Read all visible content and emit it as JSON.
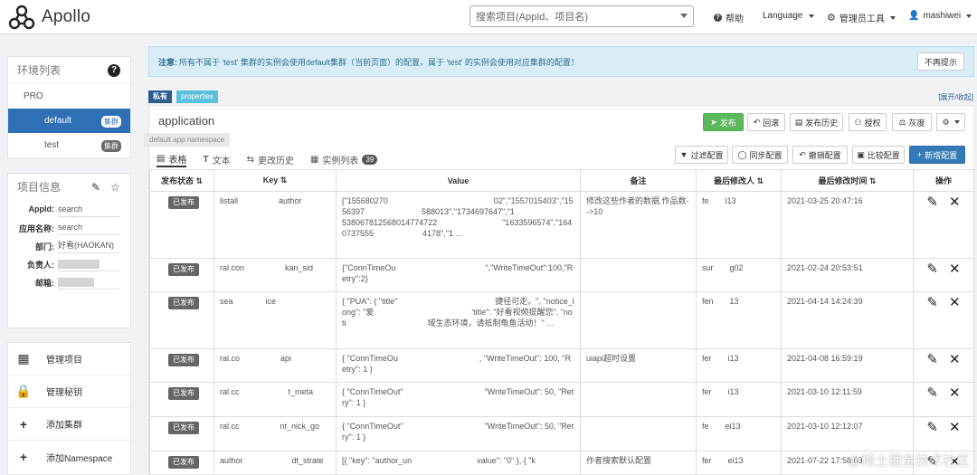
{
  "app": {
    "name": "Apollo"
  },
  "header": {
    "search_placeholder": "搜索项目(AppId、项目名)",
    "help": "帮助",
    "language": "Language",
    "admin_tools": "管理员工具",
    "user": "mashiwei"
  },
  "env": {
    "title": "环境列表",
    "help": "?",
    "env_name": "PRO",
    "clusters": [
      {
        "name": "default",
        "tag": "集群",
        "active": true
      },
      {
        "name": "test",
        "tag": "集群",
        "active": false
      }
    ]
  },
  "project_info": {
    "title": "项目信息",
    "rows": [
      {
        "label": "AppId:",
        "value": "search"
      },
      {
        "label": "应用名称:",
        "value": "search"
      },
      {
        "label": "部门:",
        "value": "好看(HAOKAN)"
      },
      {
        "label": "负责人:",
        "value": ""
      },
      {
        "label": "邮箱:",
        "value": ""
      }
    ]
  },
  "actions": [
    {
      "icon": "grid-icon",
      "label": "管理项目"
    },
    {
      "icon": "lock-icon",
      "label": "管理秘钥"
    },
    {
      "icon": "plus-icon",
      "label": "添加集群"
    },
    {
      "icon": "plus-icon",
      "label": "添加Namespace"
    }
  ],
  "notice": {
    "prefix": "注意:",
    "text": "所有不属于 'test' 集群的实例会使用default集群（当前页面）的配置，属于 'test' 的实例会使用对应集群的配置！",
    "button": "不再提示"
  },
  "namespace": {
    "badge_private": "私有",
    "badge_format": "properties",
    "expand": "[展开/收起]",
    "title": "application",
    "tooltip": "default app namespace",
    "buttons": {
      "publish": "发布",
      "rollback": "回滚",
      "history": "发布历史",
      "grant": "授权",
      "gray": "灰度",
      "filter": "过滤配置",
      "sync": "同步配置",
      "revoke": "撤销配置",
      "compare": "比较配置",
      "add": "新增配置"
    },
    "tabs": [
      {
        "label": "表格",
        "active": true
      },
      {
        "label": "文本",
        "active": false
      },
      {
        "label": "更改历史",
        "active": false
      },
      {
        "label": "实例列表",
        "active": false,
        "count": "39"
      }
    ],
    "columns": [
      "发布状态",
      "Key",
      "Value",
      "备注",
      "最后修改人",
      "最后修改时间",
      "操作"
    ],
    "rows": [
      {
        "status": "已发布",
        "key": "listall　　　　　author",
        "value": "[\"155680270　　　　　　　　　　　　　02\",\"1557015403\",\"1556397　　　　　　　588013\",\"1734697647\",\"1　　　　　　　　　　538067812568014774722　　　　　　　　\"1633596574\",\"1640737555　　　　　　4178\",\"1 ...",
        "remark": "修改这些作者的数据.作品数-->10",
        "user": "fe　　i13",
        "time": "2021-03-25 20:47:16"
      },
      {
        "status": "已发布",
        "key": "ral.con　　　　　kan_sid",
        "value": "{\"ConnTimeOu　　　　　　　　　　　\",\"WriteTimeOut\":100,\"Retry\":2}",
        "remark": "",
        "user": "sur　　g02",
        "time": "2021-02-24 20:53:51"
      },
      {
        "status": "已发布",
        "key": "sea　　　　ice",
        "value": "{ \"PUA\": { \"title\"　　　　　　　　　　　　捷径可走。\", \"notice_long\": \"爱　　　　　　　　　　　　'title\": \"好看视频提醒您\", \"noti　　　　　　　　　　域生态环境，请抵制龟鱼活动！\" ...",
        "remark": "",
        "user": "fen　　13",
        "time": "2021-04-14 14:24:39"
      },
      {
        "status": "已发布",
        "key": "ral.co　　　　　api",
        "value": "{ \"ConnTimeOu　　　　　　　　　　, \"WriteTimeOut\": 100, \"Retry\": 1 }",
        "remark": "uiapi超时设置",
        "user": "fer　　i13",
        "time": "2021-04-08 16:59:19"
      },
      {
        "status": "已发布",
        "key": "ral.cc　　　　　　t_meta",
        "value": "{ \"ConnTimeOut\"　　　　　　　　　　\"WriteTimeOut\": 50, \"Retry\": 1 }",
        "remark": "",
        "user": "fer　　i13",
        "time": "2021-03-10 12:11:59"
      },
      {
        "status": "已发布",
        "key": "ral.cc　　　　　nt_nick_go",
        "value": "{ \"ConnTimeOut\"　　　　　　　　　　\"WriteTimeOut\": 50, \"Retry\": 1 }",
        "remark": "",
        "user": "fe　　ei13",
        "time": "2021-03-10 12:12:07"
      },
      {
        "status": "已发布",
        "key": "author　　　　　　dt_strate",
        "value": "[{ \"key\": \"author_un　　　　　　　　value\": \"0\" }, { \"k",
        "remark": "作者搜索默认配置",
        "user": "fer　　ei13",
        "time": "2021-07-22 17:58:03"
      }
    ]
  },
  "watermark": "@稀土掘金技术社区"
}
